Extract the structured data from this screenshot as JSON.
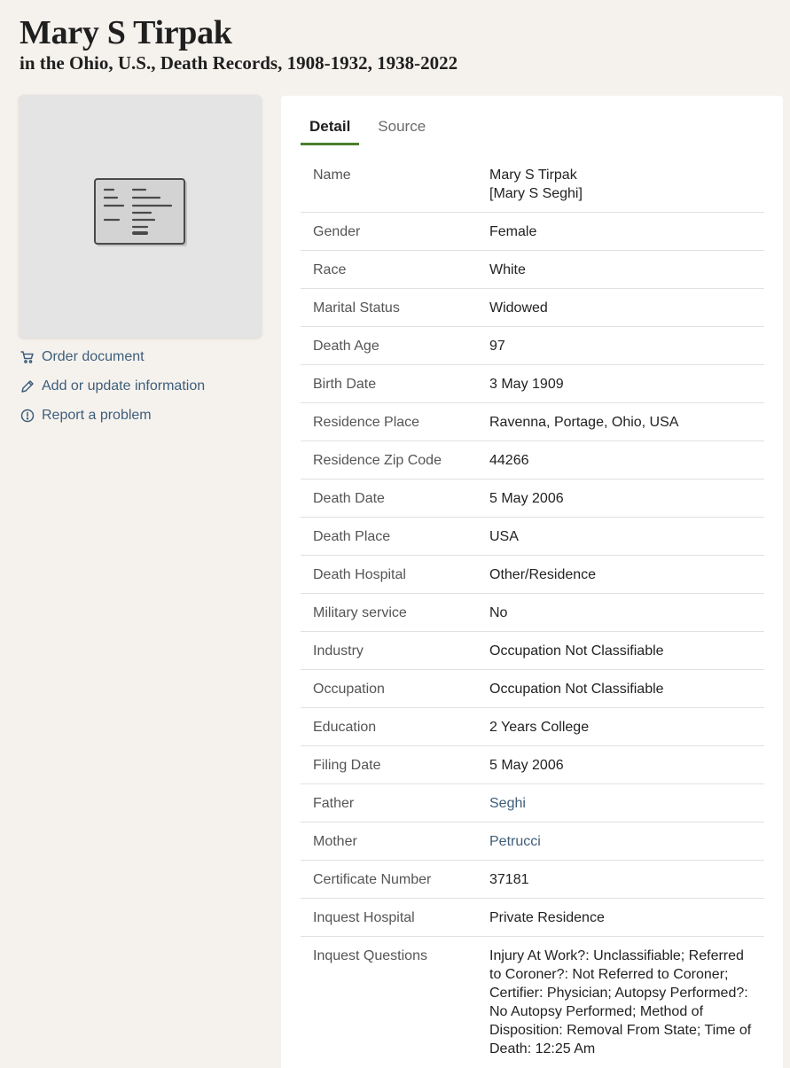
{
  "header": {
    "name": "Mary S Tirpak",
    "collection": "in the Ohio, U.S., Death Records, 1908-1932, 1938-2022"
  },
  "image_placeholder": {
    "icon": "document-record-icon"
  },
  "actions": [
    {
      "icon": "cart-icon",
      "label": "Order document"
    },
    {
      "icon": "pencil-icon",
      "label": "Add or update information"
    },
    {
      "icon": "alert-circle-icon",
      "label": "Report a problem"
    }
  ],
  "tabs": [
    {
      "label": "Detail",
      "active": true
    },
    {
      "label": "Source",
      "active": false
    }
  ],
  "details": [
    {
      "label": "Name",
      "value": "Mary S Tirpak\n[Mary S Seghi]"
    },
    {
      "label": "Gender",
      "value": "Female"
    },
    {
      "label": "Race",
      "value": "White"
    },
    {
      "label": "Marital Status",
      "value": "Widowed"
    },
    {
      "label": "Death Age",
      "value": "97"
    },
    {
      "label": "Birth Date",
      "value": "3 May 1909"
    },
    {
      "label": "Residence Place",
      "value": "Ravenna, Portage, Ohio, USA"
    },
    {
      "label": "Residence Zip Code",
      "value": "44266"
    },
    {
      "label": "Death Date",
      "value": "5 May 2006"
    },
    {
      "label": "Death Place",
      "value": "USA"
    },
    {
      "label": "Death Hospital",
      "value": "Other/Residence"
    },
    {
      "label": "Military service",
      "value": "No"
    },
    {
      "label": "Industry",
      "value": "Occupation Not Classifiable"
    },
    {
      "label": "Occupation",
      "value": "Occupation Not Classifiable"
    },
    {
      "label": "Education",
      "value": "2 Years College"
    },
    {
      "label": "Filing Date",
      "value": "5 May 2006"
    },
    {
      "label": "Father",
      "value": "Seghi",
      "link": true
    },
    {
      "label": "Mother",
      "value": "Petrucci",
      "link": true
    },
    {
      "label": "Certificate Number",
      "value": "37181"
    },
    {
      "label": "Inquest Hospital",
      "value": "Private Residence"
    },
    {
      "label": "Inquest Questions",
      "value": "Injury At Work?: Unclassifiable; Referred to Coroner?: Not Referred to Coroner; Certifier: Physician; Autopsy Performed?: No Autopsy Performed; Method of Disposition: Removal From State; Time of Death: 12:25 Am"
    }
  ],
  "colors": {
    "accent_tab": "#4b7f2c",
    "link": "#3e5e7a",
    "background": "#f5f2ee"
  }
}
